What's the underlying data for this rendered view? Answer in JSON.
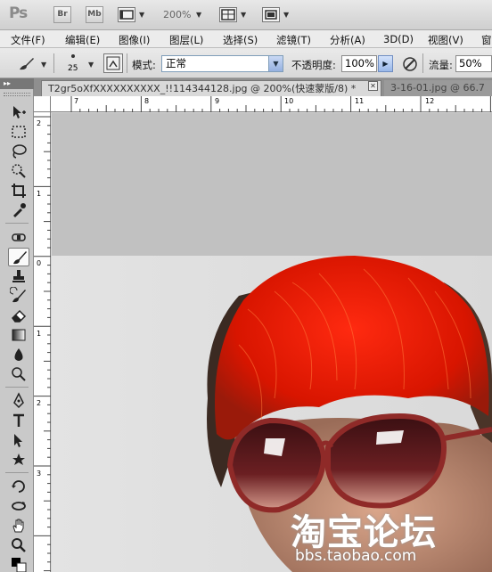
{
  "app": {
    "logo": "Ps",
    "bridge_button": "Br",
    "minibridge_button": "Mb",
    "zoom": "200%"
  },
  "menu": [
    "文件(F)",
    "编辑(E)",
    "图像(I)",
    "图层(L)",
    "选择(S)",
    "滤镜(T)",
    "分析(A)",
    "3D(D)",
    "视图(V)",
    "窗"
  ],
  "options": {
    "brush_size": "25",
    "mode_label": "模式:",
    "mode_value": "正常",
    "opacity_label": "不透明度:",
    "opacity_value": "100%",
    "flow_label": "流量:",
    "flow_value": "50%"
  },
  "tabs": [
    {
      "title": "T2gr5oXfXXXXXXXXXX_!!114344128.jpg @ 200%(快速蒙版/8) *",
      "active": true
    },
    {
      "title": "3-16-01.jpg @ 66.7",
      "active": false
    }
  ],
  "toolbox": {
    "header": "▸▸",
    "tools": [
      "move-tool-icon",
      "marquee-tool-icon",
      "lasso-tool-icon",
      "quick-select-tool-icon",
      "crop-tool-icon",
      "eyedropper-tool-icon",
      "healing-tool-icon",
      "brush-tool-icon",
      "clone-stamp-tool-icon",
      "history-brush-tool-icon",
      "eraser-tool-icon",
      "gradient-tool-icon",
      "blur-tool-icon",
      "dodge-tool-icon",
      "pen-tool-icon",
      "type-tool-icon",
      "path-select-tool-icon",
      "shape-tool-icon",
      "3d-rotate-tool-icon",
      "3d-orbit-tool-icon",
      "hand-tool-icon",
      "zoom-tool-icon"
    ]
  },
  "ruler": {
    "top_labels": [
      "7",
      "8",
      "9",
      "10",
      "11",
      "12"
    ],
    "left_labels": [
      "2",
      "1",
      "0",
      "1",
      "2",
      "3"
    ]
  },
  "watermark": {
    "logo_text": "淘宝论坛",
    "url": "bbs.taobao.com"
  }
}
